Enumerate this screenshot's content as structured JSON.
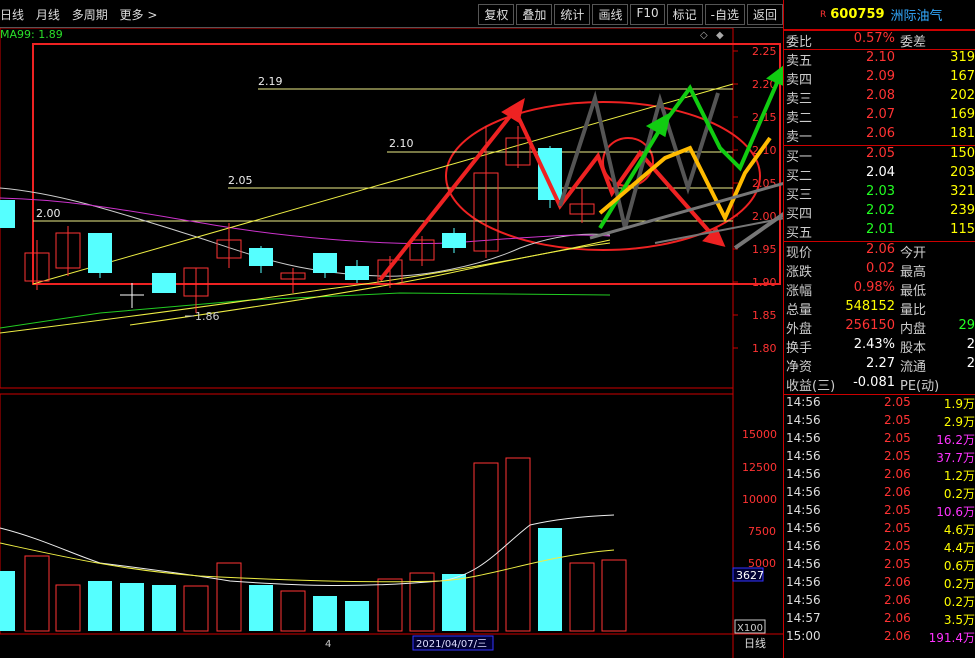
{
  "toolbar": {
    "left": [
      "日线",
      "月线",
      "多周期",
      "更多 >"
    ],
    "right": [
      "复权",
      "叠加",
      "统计",
      "画线",
      "F10",
      "标记",
      "-自选",
      "返回"
    ]
  },
  "indicator": {
    "ma99": "MA99: 1.89"
  },
  "price_axis": [
    "2.25",
    "2.20",
    "2.15",
    "2.10",
    "2.05",
    "2.00",
    "1.95",
    "1.90",
    "1.85",
    "1.80"
  ],
  "volume_axis": [
    "15000",
    "12500",
    "10000",
    "7500",
    "5000"
  ],
  "volume_marker": "3627",
  "unit_marker": "X100",
  "annotations": {
    "h219": "2.19",
    "h210": "2.10",
    "h205": "2.05",
    "h200": "2.00",
    "low": "1.86"
  },
  "date_tag": "2021/04/07/三",
  "x_tick": "4",
  "period_label": "日线",
  "stock": {
    "r": "R",
    "code": "600759",
    "name": "洲际油气"
  },
  "order_book": {
    "webi_label": "委比",
    "webi_value": "0.57%",
    "weicha_label": "委差",
    "sells": [
      {
        "label": "卖五",
        "price": "2.10",
        "vol": "319"
      },
      {
        "label": "卖四",
        "price": "2.09",
        "vol": "167"
      },
      {
        "label": "卖三",
        "price": "2.08",
        "vol": "202"
      },
      {
        "label": "卖二",
        "price": "2.07",
        "vol": "169"
      },
      {
        "label": "卖一",
        "price": "2.06",
        "vol": "181"
      }
    ],
    "buys": [
      {
        "label": "买一",
        "price": "2.05",
        "vol": "150"
      },
      {
        "label": "买二",
        "price": "2.04",
        "vol": "203"
      },
      {
        "label": "买三",
        "price": "2.03",
        "vol": "321"
      },
      {
        "label": "买四",
        "price": "2.02",
        "vol": "239"
      },
      {
        "label": "买五",
        "price": "2.01",
        "vol": "115"
      }
    ]
  },
  "quote": [
    {
      "l": "现价",
      "v": "2.06",
      "l2": "今开",
      "v2": ""
    },
    {
      "l": "涨跌",
      "v": "0.02",
      "l2": "最高",
      "v2": ""
    },
    {
      "l": "涨幅",
      "v": "0.98%",
      "l2": "最低",
      "v2": ""
    },
    {
      "l": "总量",
      "v": "548152",
      "l2": "量比",
      "v2": ""
    },
    {
      "l": "外盘",
      "v": "256150",
      "l2": "内盘",
      "v2": "29"
    },
    {
      "l": "换手",
      "v": "2.43%",
      "l2": "股本",
      "v2": "2"
    },
    {
      "l": "净资",
      "v": "2.27",
      "l2": "流通",
      "v2": "2"
    },
    {
      "l": "收益(三)",
      "v": "-0.081",
      "l2": "PE(动)",
      "v2": ""
    }
  ],
  "ticks": [
    {
      "t": "14:56",
      "p": "2.05",
      "v": "1.9万"
    },
    {
      "t": "14:56",
      "p": "2.05",
      "v": "2.9万"
    },
    {
      "t": "14:56",
      "p": "2.05",
      "v": "16.2万"
    },
    {
      "t": "14:56",
      "p": "2.05",
      "v": "37.7万"
    },
    {
      "t": "14:56",
      "p": "2.06",
      "v": "1.2万"
    },
    {
      "t": "14:56",
      "p": "2.06",
      "v": "0.2万"
    },
    {
      "t": "14:56",
      "p": "2.05",
      "v": "10.6万"
    },
    {
      "t": "14:56",
      "p": "2.05",
      "v": "4.6万"
    },
    {
      "t": "14:56",
      "p": "2.05",
      "v": "4.4万"
    },
    {
      "t": "14:56",
      "p": "2.05",
      "v": "0.6万"
    },
    {
      "t": "14:56",
      "p": "2.06",
      "v": "0.2万"
    },
    {
      "t": "14:56",
      "p": "2.06",
      "v": "0.2万"
    },
    {
      "t": "14:57",
      "p": "2.06",
      "v": "3.5万"
    },
    {
      "t": "15:00",
      "p": "2.06",
      "v": "191.4万"
    }
  ]
}
